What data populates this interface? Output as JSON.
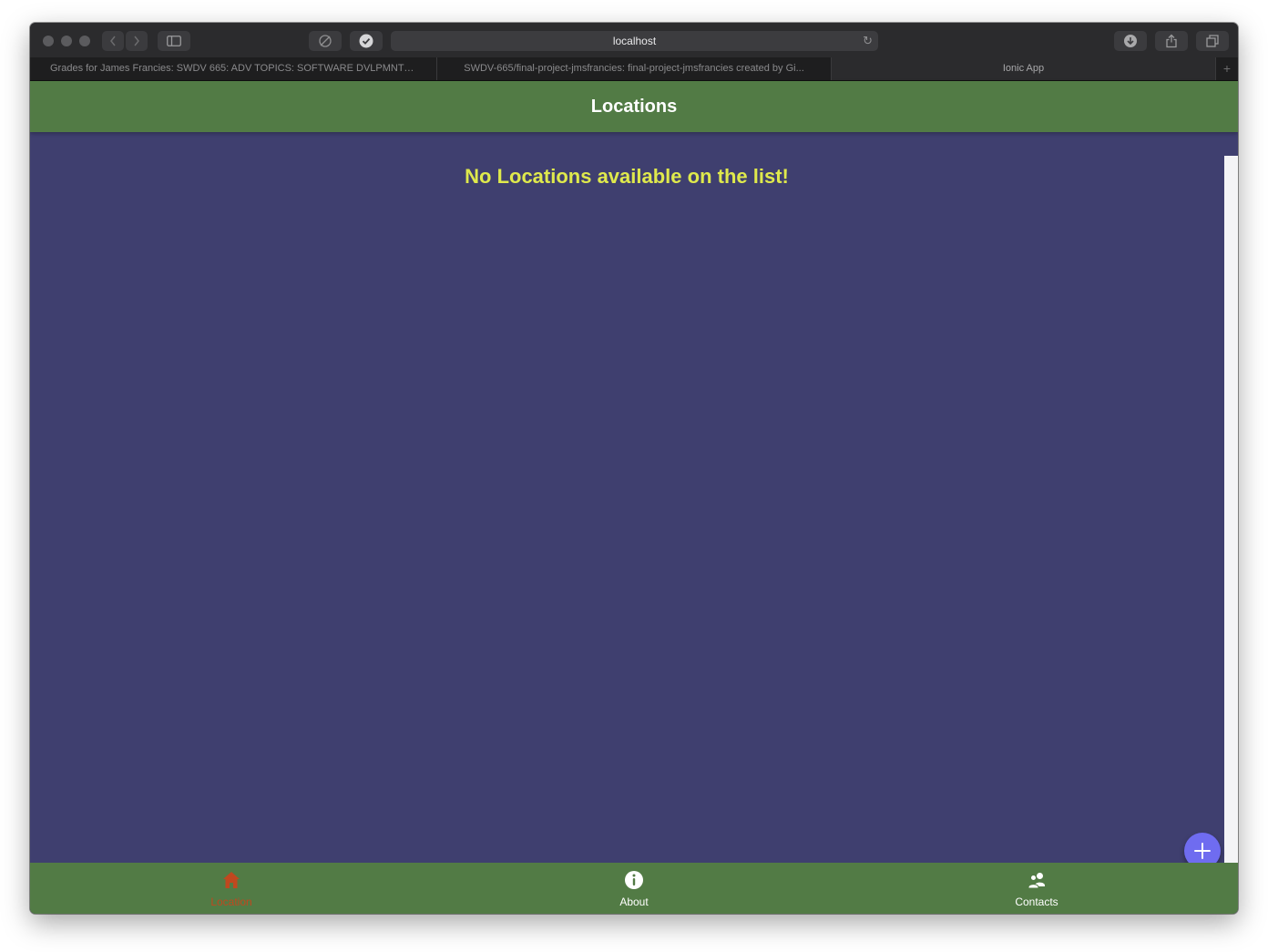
{
  "browser": {
    "url": "localhost",
    "tabs": [
      {
        "label": "Grades for James Francies: SWDV 665: ADV TOPICS: SOFTWARE DVLPMNT 1..."
      },
      {
        "label": "SWDV-665/final-project-jmsfrancies: final-project-jmsfrancies created by Gi..."
      },
      {
        "label": "Ionic App"
      }
    ],
    "new_tab_symbol": "+"
  },
  "app": {
    "header_title": "Locations",
    "empty_message": "No Locations available on the list!",
    "fab_icon": "add-icon",
    "bottom_tabs": [
      {
        "label": "Location",
        "icon": "home-icon",
        "selected": true
      },
      {
        "label": "About",
        "icon": "info-icon",
        "selected": false
      },
      {
        "label": "Contacts",
        "icon": "people-icon",
        "selected": false
      }
    ]
  },
  "colors": {
    "header_bg": "#527b45",
    "content_bg": "#3f3f6f",
    "empty_text": "#dfe94c",
    "fab": "#6f6cf0",
    "selected_tab": "#c0481f"
  }
}
